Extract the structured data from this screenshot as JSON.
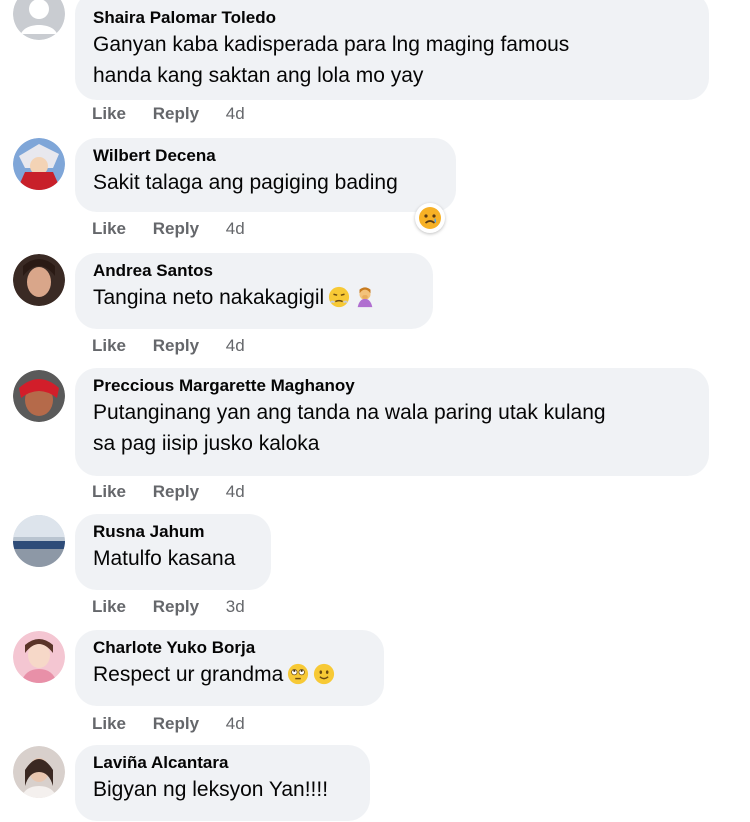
{
  "comments": [
    {
      "author": "Shaira Palomar Toledo",
      "lines": [
        "Ganyan kaba kadisperada para lng maging famous",
        "handa kang saktan ang lola mo yay"
      ],
      "like": "Like",
      "reply": "Reply",
      "time": "4d",
      "avatar": "default-avatar"
    },
    {
      "author": "Wilbert Decena",
      "lines": [
        "Sakit talaga ang pagiging bading"
      ],
      "like": "Like",
      "reply": "Reply",
      "time": "4d",
      "avatar": "anime-avatar",
      "reaction": "sad-reaction-icon"
    },
    {
      "author": "Andrea Santos",
      "lines": [
        "Tangina neto nakakagigil"
      ],
      "emojis": [
        "steam-from-nose-emoji",
        "person-facepalming-emoji"
      ],
      "like": "Like",
      "reply": "Reply",
      "time": "4d",
      "avatar": "photo-avatar"
    },
    {
      "author": "Preccious Margarette Maghanoy",
      "lines": [
        "Putanginang yan ang tanda na wala paring utak kulang",
        "sa pag iisip jusko kaloka"
      ],
      "like": "Like",
      "reply": "Reply",
      "time": "4d",
      "avatar": "red-photo-avatar"
    },
    {
      "author": "Rusna Jahum",
      "lines": [
        "Matulfo kasana"
      ],
      "like": "Like",
      "reply": "Reply",
      "time": "3d",
      "avatar": "landscape-avatar"
    },
    {
      "author": "Charlote Yuko Borja",
      "lines": [
        "Respect ur grandma"
      ],
      "emojis": [
        "face-with-rolling-eyes-emoji",
        "slightly-smiling-face-emoji"
      ],
      "like": "Like",
      "reply": "Reply",
      "time": "4d",
      "avatar": "pink-photo-avatar"
    },
    {
      "author": "Laviña Alcantara",
      "lines": [
        "Bigyan ng leksyon Yan!!!!"
      ],
      "avatar": "portrait-avatar"
    }
  ]
}
